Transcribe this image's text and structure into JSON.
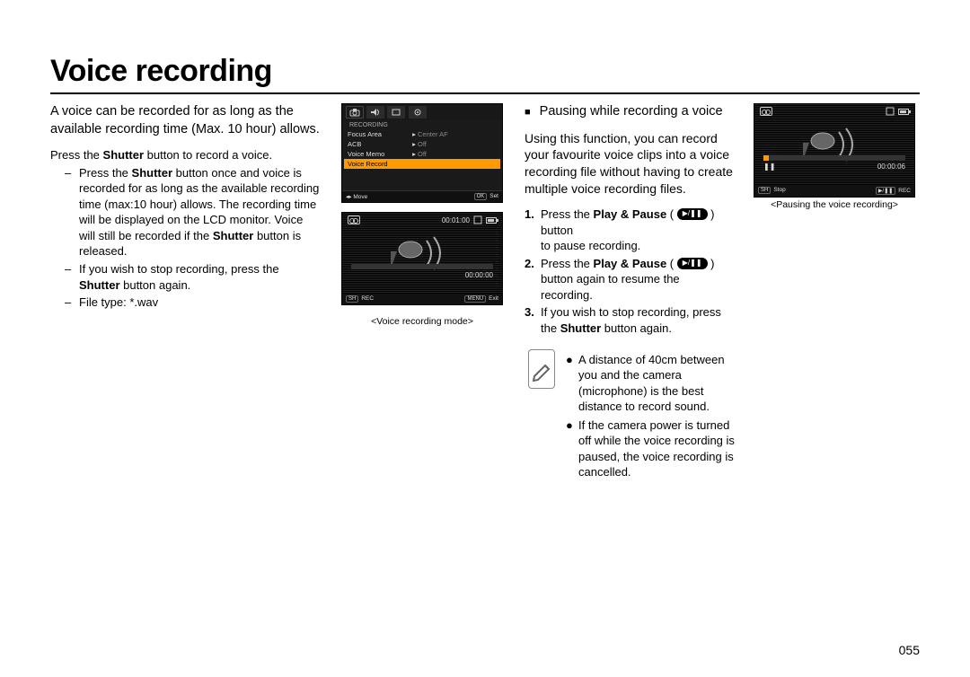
{
  "title": "Voice recording",
  "page_number": "055",
  "left": {
    "intro_l1": "A voice can be recorded for as long as the available recording time (Max. 10 hour) allows.",
    "press_shutter": "Press the ",
    "shutter_word": "Shutter",
    "press_shutter_tail": " button to record a voice.",
    "d1_a": "Press the ",
    "d1_b": "Shutter",
    "d1_c": " button once and voice is recorded for as long as the available recording time (max:10 hour) allows. The recording time will be displayed on the LCD monitor. Voice will still be recorded if the ",
    "d1_d": "Shutter",
    "d1_e": " button is released.",
    "d2_a": "If you wish to stop recording, press the ",
    "d2_b": "Shutter",
    "d2_c": " button again.",
    "d3": "File type: *.wav"
  },
  "lcd1": {
    "heading": "RECORDING",
    "rows": [
      {
        "label": "Focus Area",
        "value": "Center AF"
      },
      {
        "label": "ACB",
        "value": "Off"
      },
      {
        "label": "Voice Memo",
        "value": "Off"
      },
      {
        "label": "Voice Record",
        "value": ""
      }
    ],
    "foot_left": "Move",
    "foot_right_key": "OK",
    "foot_right": "Set"
  },
  "lcd2": {
    "top_time": "00:01:00",
    "progress_time": "00:00:00",
    "foot_l_key": "SH",
    "foot_l": "REC",
    "foot_r_key": "MENU",
    "foot_r": "Exit",
    "caption": "<Voice recording mode>"
  },
  "right": {
    "section_title": "Pausing while recording a voice",
    "intro": "Using this function, you can record your favourite voice clips into a voice recording file without having to create multiple voice recording files.",
    "s1_a": "Press the ",
    "s1_b": "Play & Pause",
    "s1_tail_a": " button",
    "s1_line2": "to pause recording.",
    "s2_a": "Press the ",
    "s2_b": "Play & Pause",
    "s2_tail": " button again to resume the recording.",
    "s3_a": "If you wish to stop recording, press the ",
    "s3_b": "Shutter",
    "s3_c": " button again.",
    "note1": "A distance of 40cm between you and the camera (microphone) is the best distance to record sound.",
    "note2": "If the camera power is turned off while the voice recording is paused, the voice recording is cancelled."
  },
  "lcd3": {
    "progress_time": "00:00:06",
    "foot_l_key": "SH",
    "foot_l": "Stop",
    "foot_r": "REC",
    "caption": "<Pausing the voice recording>"
  },
  "icons": {
    "play_pause": "▶/❚❚",
    "note": "✎"
  }
}
